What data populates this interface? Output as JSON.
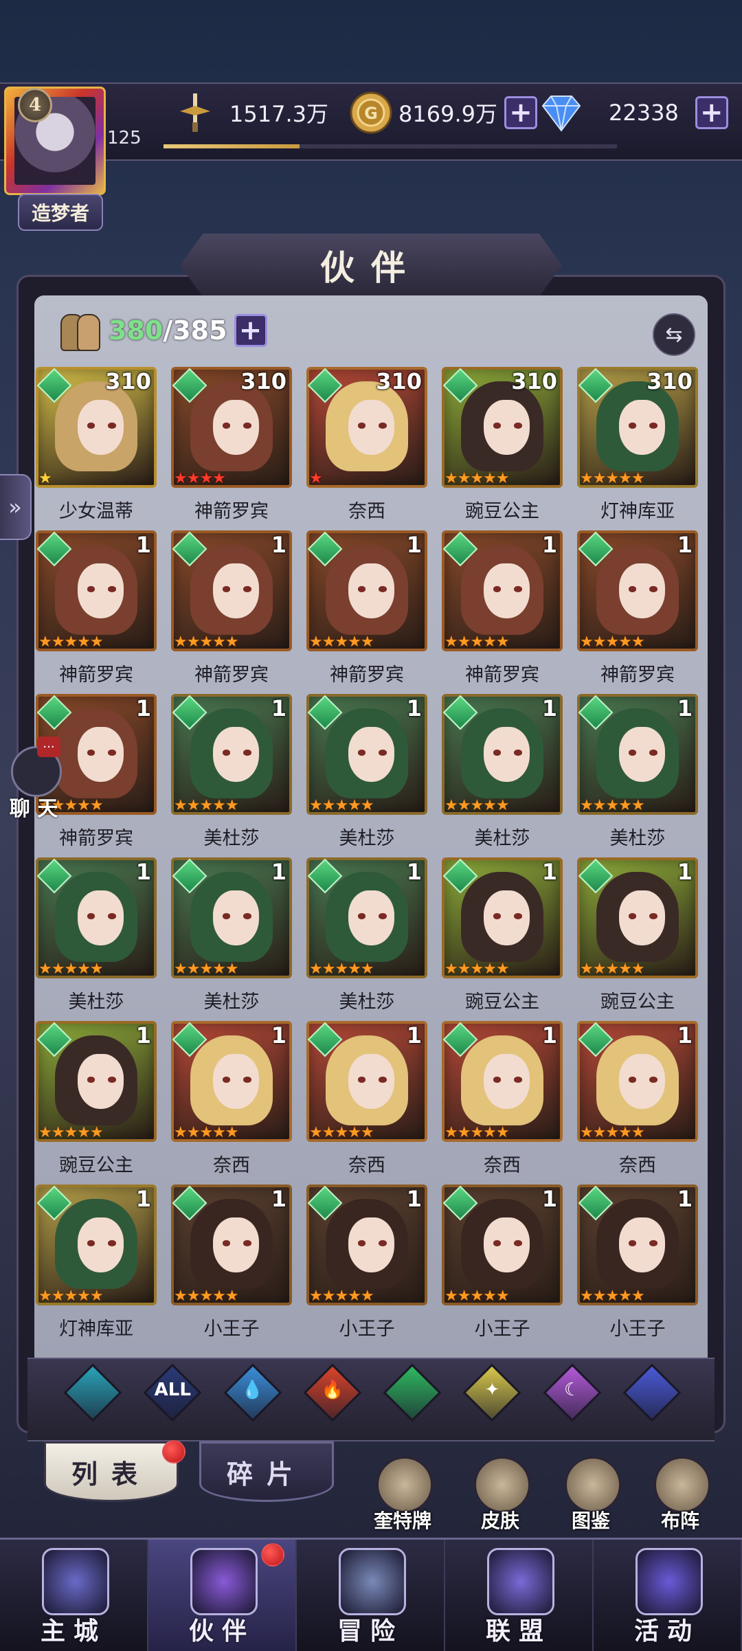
{
  "player": {
    "vip_level": "4",
    "level": "125",
    "title": "造梦者",
    "exp_fraction": 0.3
  },
  "resources": {
    "power": "1517.3万",
    "gold": "8169.9万",
    "gems": "22338"
  },
  "header": {
    "title": "伙伴"
  },
  "roster": {
    "current": "380",
    "capacity": "/385"
  },
  "heroes": [
    {
      "name": "少女温蒂",
      "level": "310",
      "stars": 1,
      "star_color": "yellow",
      "palette": "wendy"
    },
    {
      "name": "神箭罗宾",
      "level": "310",
      "stars": 4,
      "star_color": "red",
      "palette": "robin"
    },
    {
      "name": "奈西",
      "level": "310",
      "stars": 1,
      "star_color": "red",
      "palette": "naxi"
    },
    {
      "name": "豌豆公主",
      "level": "310",
      "stars": 5,
      "star_color": "orange",
      "palette": "pea"
    },
    {
      "name": "灯神库亚",
      "level": "310",
      "stars": 5,
      "star_color": "orange",
      "palette": "genie"
    },
    {
      "name": "神箭罗宾",
      "level": "1",
      "stars": 5,
      "star_color": "orange",
      "palette": "robin"
    },
    {
      "name": "神箭罗宾",
      "level": "1",
      "stars": 5,
      "star_color": "orange",
      "palette": "robin"
    },
    {
      "name": "神箭罗宾",
      "level": "1",
      "stars": 5,
      "star_color": "orange",
      "palette": "robin"
    },
    {
      "name": "神箭罗宾",
      "level": "1",
      "stars": 5,
      "star_color": "orange",
      "palette": "robin"
    },
    {
      "name": "神箭罗宾",
      "level": "1",
      "stars": 5,
      "star_color": "orange",
      "palette": "robin"
    },
    {
      "name": "神箭罗宾",
      "level": "1",
      "stars": 5,
      "star_color": "orange",
      "palette": "robin"
    },
    {
      "name": "美杜莎",
      "level": "1",
      "stars": 5,
      "star_color": "orange",
      "palette": "medusa"
    },
    {
      "name": "美杜莎",
      "level": "1",
      "stars": 5,
      "star_color": "orange",
      "palette": "medusa"
    },
    {
      "name": "美杜莎",
      "level": "1",
      "stars": 5,
      "star_color": "orange",
      "palette": "medusa"
    },
    {
      "name": "美杜莎",
      "level": "1",
      "stars": 5,
      "star_color": "orange",
      "palette": "medusa"
    },
    {
      "name": "美杜莎",
      "level": "1",
      "stars": 5,
      "star_color": "orange",
      "palette": "medusa"
    },
    {
      "name": "美杜莎",
      "level": "1",
      "stars": 5,
      "star_color": "orange",
      "palette": "medusa"
    },
    {
      "name": "美杜莎",
      "level": "1",
      "stars": 5,
      "star_color": "orange",
      "palette": "medusa"
    },
    {
      "name": "豌豆公主",
      "level": "1",
      "stars": 5,
      "star_color": "orange",
      "palette": "pea"
    },
    {
      "name": "豌豆公主",
      "level": "1",
      "stars": 5,
      "star_color": "orange",
      "palette": "pea"
    },
    {
      "name": "豌豆公主",
      "level": "1",
      "stars": 5,
      "star_color": "orange",
      "palette": "pea"
    },
    {
      "name": "奈西",
      "level": "1",
      "stars": 5,
      "star_color": "orange",
      "palette": "naxi"
    },
    {
      "name": "奈西",
      "level": "1",
      "stars": 5,
      "star_color": "orange",
      "palette": "naxi"
    },
    {
      "name": "奈西",
      "level": "1",
      "stars": 5,
      "star_color": "orange",
      "palette": "naxi"
    },
    {
      "name": "奈西",
      "level": "1",
      "stars": 5,
      "star_color": "orange",
      "palette": "naxi"
    },
    {
      "name": "灯神库亚",
      "level": "1",
      "stars": 5,
      "star_color": "orange",
      "palette": "genie"
    },
    {
      "name": "小王子",
      "level": "1",
      "stars": 5,
      "star_color": "orange",
      "palette": "prince"
    },
    {
      "name": "小王子",
      "level": "1",
      "stars": 5,
      "star_color": "orange",
      "palette": "prince"
    },
    {
      "name": "小王子",
      "level": "1",
      "stars": 5,
      "star_color": "orange",
      "palette": "prince"
    },
    {
      "name": "小王子",
      "level": "1",
      "stars": 5,
      "star_color": "orange",
      "palette": "prince"
    }
  ],
  "palettes": {
    "wendy": {
      "bg": "#d8c24a",
      "hair": "#c9a468",
      "border": "#b8902c"
    },
    "robin": {
      "bg": "#8a4a2a",
      "hair": "#7a3f2e",
      "border": "#9a5a24"
    },
    "naxi": {
      "bg": "#b84a38",
      "hair": "#e3c27a",
      "border": "#a86a2a"
    },
    "pea": {
      "bg": "#8fae3a",
      "hair": "#3a2a26",
      "border": "#9a6a24"
    },
    "genie": {
      "bg": "#b8a24a",
      "hair": "#2f5a3a",
      "border": "#9a7a2a"
    },
    "medusa": {
      "bg": "#4a7a52",
      "hair": "#2f5a3a",
      "border": "#8a6a2a"
    },
    "prince": {
      "bg": "#5a4030",
      "hair": "#3a2620",
      "border": "#8a5a24"
    }
  },
  "filters": [
    {
      "label": "",
      "icon": "arch-diamond-icon",
      "color": "#2aa3b8"
    },
    {
      "label": "ALL",
      "icon": "all-diamond-icon",
      "color": "#2a3a78"
    },
    {
      "label": "💧",
      "icon": "water-diamond-icon",
      "color": "#3a8ed8"
    },
    {
      "label": "🔥",
      "icon": "fire-diamond-icon",
      "color": "#d8442a"
    },
    {
      "label": "",
      "icon": "wind-diamond-icon",
      "color": "#2fb860"
    },
    {
      "label": "✦",
      "icon": "light-diamond-icon",
      "color": "#d8c84a"
    },
    {
      "label": "☾",
      "icon": "dark-diamond-icon",
      "color": "#b35ad8"
    },
    {
      "label": "",
      "icon": "orbit-diamond-icon",
      "color": "#4a5ad8"
    }
  ],
  "side": {
    "chat_label": "聊 天",
    "chat_badge": "...",
    "expand_glyph": "»"
  },
  "subtabs": {
    "list": "列表",
    "fragments": "碎片"
  },
  "shortcuts": [
    {
      "label": "奎特牌",
      "icon": "card-deck-icon"
    },
    {
      "label": "皮肤",
      "icon": "skin-icon"
    },
    {
      "label": "图鉴",
      "icon": "codex-icon"
    },
    {
      "label": "布阵",
      "icon": "formation-icon"
    }
  ],
  "nav": [
    {
      "label": "主城",
      "icon": "castle-icon",
      "color": "#6a6ac8"
    },
    {
      "label": "伙伴",
      "icon": "witch-hat-icon",
      "color": "#8a5ad8"
    },
    {
      "label": "冒险",
      "icon": "compass-icon",
      "color": "#7a8ab8"
    },
    {
      "label": "联盟",
      "icon": "shield-icon",
      "color": "#7a6ad8"
    },
    {
      "label": "活动",
      "icon": "cards-icon",
      "color": "#6a5ad8"
    }
  ]
}
